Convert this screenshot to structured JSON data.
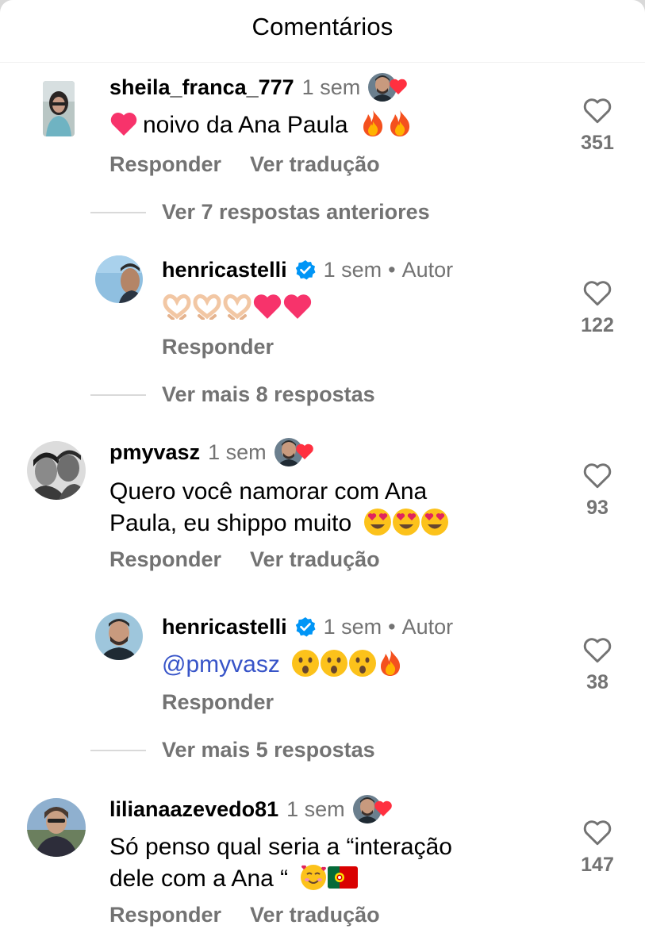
{
  "header": {
    "title": "Comentários"
  },
  "comments": [
    {
      "username": "sheila_franca_777",
      "time": "1 sem",
      "text": "noivo da Ana Paula",
      "reply_label": "Responder",
      "translate_label": "Ver tradução",
      "likes": "351"
    },
    {
      "username": "henricastelli",
      "time": "1 sem",
      "separator": "•",
      "author_label": "Autor",
      "reply_label": "Responder",
      "likes": "122"
    },
    {
      "username": "pmyvasz",
      "time": "1 sem",
      "text_line1": "Quero você namorar com Ana",
      "text_line2": "Paula, eu shippo muito",
      "reply_label": "Responder",
      "translate_label": "Ver tradução",
      "likes": "93"
    },
    {
      "username": "henricastelli",
      "time": "1 sem",
      "separator": "•",
      "author_label": "Autor",
      "mention": "@pmyvasz",
      "reply_label": "Responder",
      "likes": "38"
    },
    {
      "username": "lilianaazevedo81",
      "time": "1 sem",
      "text_line1": "Só penso qual seria a “interação",
      "text_line2": "dele com a Ana “",
      "reply_label": "Responder",
      "translate_label": "Ver tradução",
      "likes": "147"
    }
  ],
  "thread_links": {
    "previous_replies": "Ver 7 respostas anteriores",
    "more_replies_1": "Ver mais 8 respostas",
    "more_replies_2": "Ver mais 5 respostas"
  },
  "colors": {
    "muted_text": "#737373",
    "verified_blue": "#0095f6",
    "heart_red": "#ff3040",
    "mention_blue": "#3754c8"
  },
  "icons": [
    "heart-outline-icon",
    "verified-badge-icon",
    "red-heart-icon"
  ]
}
